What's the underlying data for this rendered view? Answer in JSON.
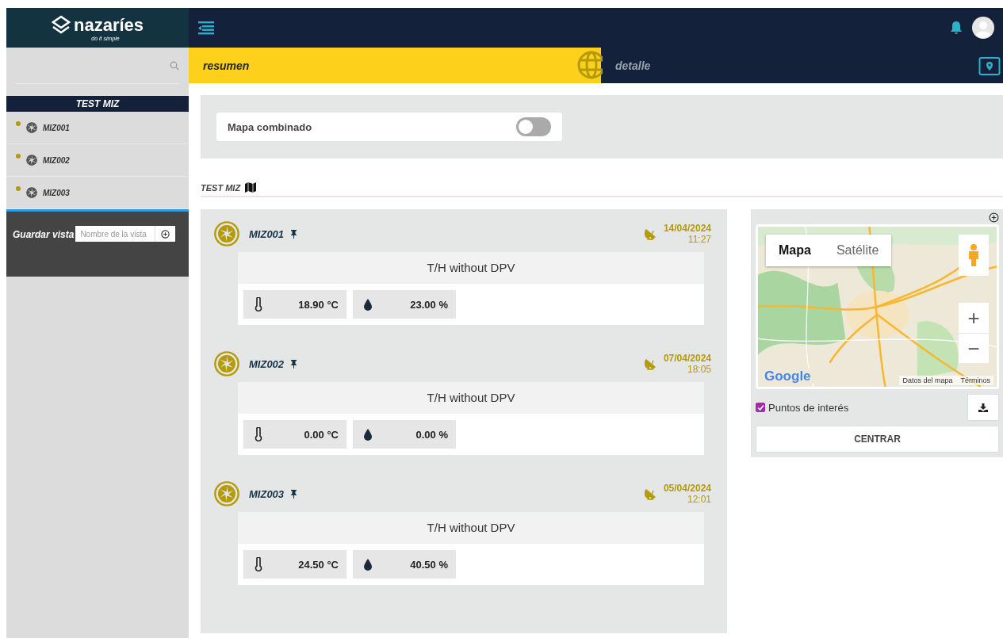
{
  "logo": {
    "name": "nazaríes",
    "tagline": "do it simple"
  },
  "sidebar": {
    "group": "TEST MIZ",
    "items": [
      {
        "name": "MIZ001",
        "color": "#b59a0a"
      },
      {
        "name": "MIZ002",
        "color": "#b59a0a"
      },
      {
        "name": "MIZ003",
        "color": "#b59a0a"
      }
    ],
    "save_view": {
      "label": "Guardar vista",
      "placeholder": "Nombre de la vista"
    }
  },
  "tabs": [
    {
      "label": "resumen",
      "selected": true
    },
    {
      "label": "detalle",
      "selected": false
    }
  ],
  "combined_map": {
    "label": "Mapa combinado",
    "on": false
  },
  "section": {
    "title": "TEST MIZ"
  },
  "devices": [
    {
      "name": "MIZ001",
      "date": "14/04/2024",
      "time": "11:27",
      "subtitle": "T/H without DPV",
      "readings": [
        {
          "kind": "temperature",
          "value": "18.90 °C"
        },
        {
          "kind": "humidity",
          "value": "23.00 %"
        }
      ]
    },
    {
      "name": "MIZ002",
      "date": "07/04/2024",
      "time": "18:05",
      "subtitle": "T/H without DPV",
      "readings": [
        {
          "kind": "temperature",
          "value": "0.00 °C"
        },
        {
          "kind": "humidity",
          "value": "0.00 %"
        }
      ]
    },
    {
      "name": "MIZ003",
      "date": "05/04/2024",
      "time": "12:01",
      "subtitle": "T/H without DPV",
      "readings": [
        {
          "kind": "temperature",
          "value": "24.50 °C"
        },
        {
          "kind": "humidity",
          "value": "40.50 %"
        }
      ]
    }
  ],
  "map": {
    "map_types": [
      {
        "label": "Mapa",
        "selected": true
      },
      {
        "label": "Satélite",
        "selected": false
      }
    ],
    "zoom_in": "+",
    "zoom_out": "−",
    "attribution": "Google",
    "map_data": "Datos del mapa",
    "terms": "Términos",
    "poi": {
      "label": "Puntos de interés",
      "checked": true
    },
    "center_button": "CENTRAR"
  }
}
